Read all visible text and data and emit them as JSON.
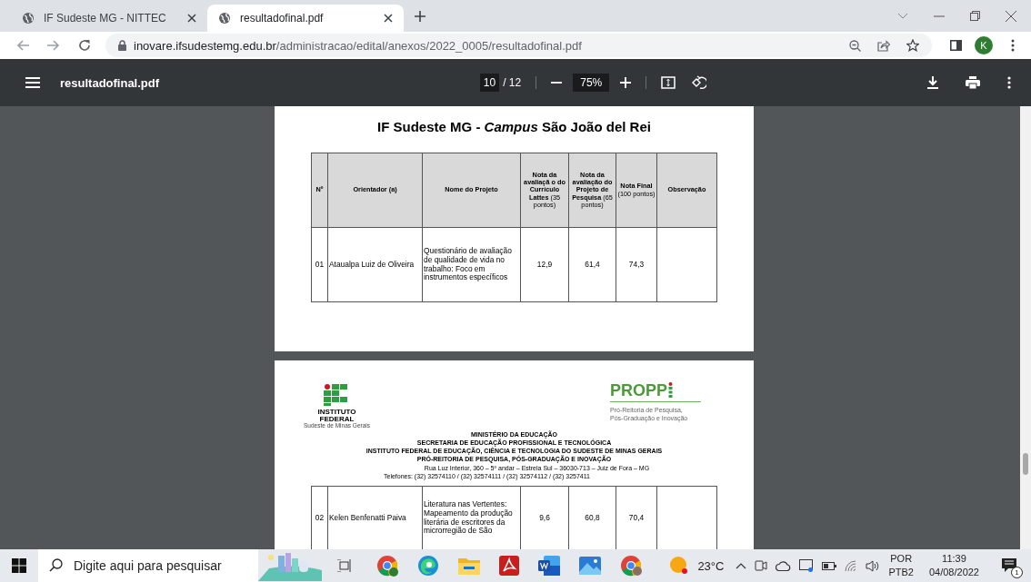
{
  "browser": {
    "tabs": [
      {
        "title": "IF Sudeste MG - NITTEC",
        "selected": false
      },
      {
        "title": "resultadofinal.pdf",
        "selected": true
      }
    ],
    "address": {
      "host": "inovare.ifsudestemg.edu.br",
      "path": "/administracao/edital/anexos/2022_0005/resultadofinal.pdf"
    },
    "profile": "K"
  },
  "pdf_toolbar": {
    "title": "resultadofinal.pdf",
    "page": "10",
    "page_count": "/ 12",
    "zoom": "75%"
  },
  "pages": [
    {
      "title": "IF Sudeste MG - *Campus* São João del Rei",
      "columns": [
        "**Nº**",
        "**Orientador (a)**",
        "**Nome do Projeto**",
        "**Nota da avaliaçã o do Currículo Lattes** (35 pontos)",
        "**Nota da avaliação do Projeto de Pesquisa** (65 pontos)",
        "**Nota Final** (100 pontos)",
        "**Observação**"
      ],
      "rows": [
        [
          "01",
          "Ataualpa Luiz de Oliveira",
          "Questionário de avaliação de qualidade de vida no trabalho: Foco em instrumentos específicos",
          "12,9",
          "61,4",
          "74,3",
          ""
        ]
      ]
    },
    {
      "logo_left": {
        "name": "INSTITUTO FEDERAL",
        "subtitle": "Sudeste de Minas Gerais"
      },
      "logo_right": {
        "name": "PROPP",
        "subtitle": [
          "Pró-Reitoria de Pesquisa,",
          "Pós-Graduação e Inovação"
        ]
      },
      "letterhead": [
        "MINISTÉRIO DA EDUCAÇÃO",
        "SECRETARIA DE EDUCAÇÃO PROFISSIONAL E TECNOLÓGICA",
        "INSTITUTO FEDERAL DE EDUCAÇÃO, CIÊNCIA E TECNOLOGIA DO SUDESTE DE MINAS GERAIS",
        "PRÓ-REITORIA DE PESQUISA, PÓS-GRADUAÇÃO E INOVAÇÃO"
      ],
      "address": "Rua Luz Interior, 360 – 5º andar – Estrela Sul – 36030-713 – Juiz de Fora – MG",
      "phones": "Telefones: (32) 32574110 / (32) 32574111 / (32) 32574112 / (32) 3257411",
      "rows": [
        [
          "02",
          "Kelen Benfenatti Paiva",
          "Literatura nas Vertentes: Mapeamento da produção literária de escritores da microrregião de São",
          "9,6",
          "60,8",
          "70,4",
          ""
        ]
      ]
    }
  ],
  "taskbar": {
    "search_placeholder": "Digite aqui para pesquisar",
    "apps": [
      {
        "kind": "chrome-profile"
      },
      {
        "kind": "edge"
      },
      {
        "kind": "folder"
      },
      {
        "kind": "pdf"
      },
      {
        "kind": "word"
      },
      {
        "kind": "photos"
      },
      {
        "kind": "chrome"
      }
    ],
    "temperature": "23°C",
    "language": "POR",
    "layout": "PTB2",
    "time": "11:39",
    "date": "04/08/2022",
    "notifications": "1"
  }
}
